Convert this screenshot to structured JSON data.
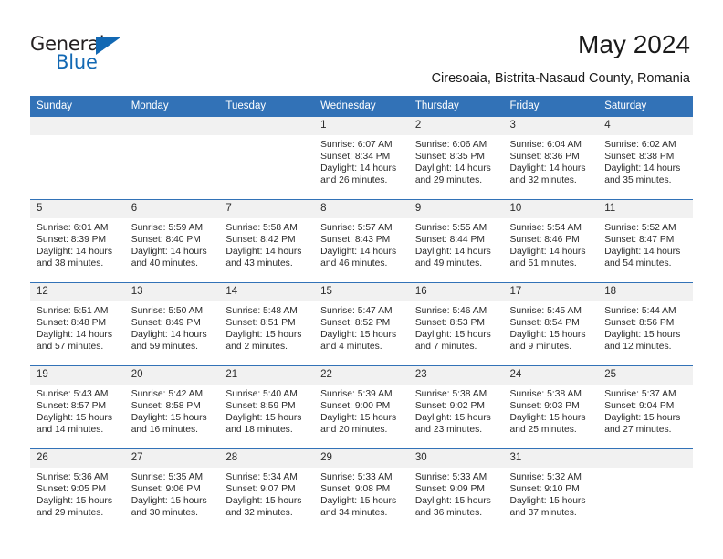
{
  "brand": {
    "name_top": "General",
    "name_bottom": "Blue",
    "triangle_icon": "triangle-icon",
    "color_black": "#231f20",
    "color_blue": "#1268b3"
  },
  "header": {
    "title": "May 2024",
    "subtitle": "Ciresoaia, Bistrita-Nasaud County, Romania"
  },
  "theme": {
    "header_blue": "#3272b7",
    "daynum_band": "#f1f1f1",
    "text": "#2b2b2b"
  },
  "calendar": {
    "weekday_headers": [
      "Sunday",
      "Monday",
      "Tuesday",
      "Wednesday",
      "Thursday",
      "Friday",
      "Saturday"
    ],
    "weeks": [
      [
        {
          "day": "",
          "empty": true,
          "sunrise": "",
          "sunset": "",
          "daylight_1": "",
          "daylight_2": ""
        },
        {
          "day": "",
          "empty": true,
          "sunrise": "",
          "sunset": "",
          "daylight_1": "",
          "daylight_2": ""
        },
        {
          "day": "",
          "empty": true,
          "sunrise": "",
          "sunset": "",
          "daylight_1": "",
          "daylight_2": ""
        },
        {
          "day": "1",
          "empty": false,
          "sunrise": "Sunrise: 6:07 AM",
          "sunset": "Sunset: 8:34 PM",
          "daylight_1": "Daylight: 14 hours",
          "daylight_2": "and 26 minutes."
        },
        {
          "day": "2",
          "empty": false,
          "sunrise": "Sunrise: 6:06 AM",
          "sunset": "Sunset: 8:35 PM",
          "daylight_1": "Daylight: 14 hours",
          "daylight_2": "and 29 minutes."
        },
        {
          "day": "3",
          "empty": false,
          "sunrise": "Sunrise: 6:04 AM",
          "sunset": "Sunset: 8:36 PM",
          "daylight_1": "Daylight: 14 hours",
          "daylight_2": "and 32 minutes."
        },
        {
          "day": "4",
          "empty": false,
          "sunrise": "Sunrise: 6:02 AM",
          "sunset": "Sunset: 8:38 PM",
          "daylight_1": "Daylight: 14 hours",
          "daylight_2": "and 35 minutes."
        }
      ],
      [
        {
          "day": "5",
          "empty": false,
          "sunrise": "Sunrise: 6:01 AM",
          "sunset": "Sunset: 8:39 PM",
          "daylight_1": "Daylight: 14 hours",
          "daylight_2": "and 38 minutes."
        },
        {
          "day": "6",
          "empty": false,
          "sunrise": "Sunrise: 5:59 AM",
          "sunset": "Sunset: 8:40 PM",
          "daylight_1": "Daylight: 14 hours",
          "daylight_2": "and 40 minutes."
        },
        {
          "day": "7",
          "empty": false,
          "sunrise": "Sunrise: 5:58 AM",
          "sunset": "Sunset: 8:42 PM",
          "daylight_1": "Daylight: 14 hours",
          "daylight_2": "and 43 minutes."
        },
        {
          "day": "8",
          "empty": false,
          "sunrise": "Sunrise: 5:57 AM",
          "sunset": "Sunset: 8:43 PM",
          "daylight_1": "Daylight: 14 hours",
          "daylight_2": "and 46 minutes."
        },
        {
          "day": "9",
          "empty": false,
          "sunrise": "Sunrise: 5:55 AM",
          "sunset": "Sunset: 8:44 PM",
          "daylight_1": "Daylight: 14 hours",
          "daylight_2": "and 49 minutes."
        },
        {
          "day": "10",
          "empty": false,
          "sunrise": "Sunrise: 5:54 AM",
          "sunset": "Sunset: 8:46 PM",
          "daylight_1": "Daylight: 14 hours",
          "daylight_2": "and 51 minutes."
        },
        {
          "day": "11",
          "empty": false,
          "sunrise": "Sunrise: 5:52 AM",
          "sunset": "Sunset: 8:47 PM",
          "daylight_1": "Daylight: 14 hours",
          "daylight_2": "and 54 minutes."
        }
      ],
      [
        {
          "day": "12",
          "empty": false,
          "sunrise": "Sunrise: 5:51 AM",
          "sunset": "Sunset: 8:48 PM",
          "daylight_1": "Daylight: 14 hours",
          "daylight_2": "and 57 minutes."
        },
        {
          "day": "13",
          "empty": false,
          "sunrise": "Sunrise: 5:50 AM",
          "sunset": "Sunset: 8:49 PM",
          "daylight_1": "Daylight: 14 hours",
          "daylight_2": "and 59 minutes."
        },
        {
          "day": "14",
          "empty": false,
          "sunrise": "Sunrise: 5:48 AM",
          "sunset": "Sunset: 8:51 PM",
          "daylight_1": "Daylight: 15 hours",
          "daylight_2": "and 2 minutes."
        },
        {
          "day": "15",
          "empty": false,
          "sunrise": "Sunrise: 5:47 AM",
          "sunset": "Sunset: 8:52 PM",
          "daylight_1": "Daylight: 15 hours",
          "daylight_2": "and 4 minutes."
        },
        {
          "day": "16",
          "empty": false,
          "sunrise": "Sunrise: 5:46 AM",
          "sunset": "Sunset: 8:53 PM",
          "daylight_1": "Daylight: 15 hours",
          "daylight_2": "and 7 minutes."
        },
        {
          "day": "17",
          "empty": false,
          "sunrise": "Sunrise: 5:45 AM",
          "sunset": "Sunset: 8:54 PM",
          "daylight_1": "Daylight: 15 hours",
          "daylight_2": "and 9 minutes."
        },
        {
          "day": "18",
          "empty": false,
          "sunrise": "Sunrise: 5:44 AM",
          "sunset": "Sunset: 8:56 PM",
          "daylight_1": "Daylight: 15 hours",
          "daylight_2": "and 12 minutes."
        }
      ],
      [
        {
          "day": "19",
          "empty": false,
          "sunrise": "Sunrise: 5:43 AM",
          "sunset": "Sunset: 8:57 PM",
          "daylight_1": "Daylight: 15 hours",
          "daylight_2": "and 14 minutes."
        },
        {
          "day": "20",
          "empty": false,
          "sunrise": "Sunrise: 5:42 AM",
          "sunset": "Sunset: 8:58 PM",
          "daylight_1": "Daylight: 15 hours",
          "daylight_2": "and 16 minutes."
        },
        {
          "day": "21",
          "empty": false,
          "sunrise": "Sunrise: 5:40 AM",
          "sunset": "Sunset: 8:59 PM",
          "daylight_1": "Daylight: 15 hours",
          "daylight_2": "and 18 minutes."
        },
        {
          "day": "22",
          "empty": false,
          "sunrise": "Sunrise: 5:39 AM",
          "sunset": "Sunset: 9:00 PM",
          "daylight_1": "Daylight: 15 hours",
          "daylight_2": "and 20 minutes."
        },
        {
          "day": "23",
          "empty": false,
          "sunrise": "Sunrise: 5:38 AM",
          "sunset": "Sunset: 9:02 PM",
          "daylight_1": "Daylight: 15 hours",
          "daylight_2": "and 23 minutes."
        },
        {
          "day": "24",
          "empty": false,
          "sunrise": "Sunrise: 5:38 AM",
          "sunset": "Sunset: 9:03 PM",
          "daylight_1": "Daylight: 15 hours",
          "daylight_2": "and 25 minutes."
        },
        {
          "day": "25",
          "empty": false,
          "sunrise": "Sunrise: 5:37 AM",
          "sunset": "Sunset: 9:04 PM",
          "daylight_1": "Daylight: 15 hours",
          "daylight_2": "and 27 minutes."
        }
      ],
      [
        {
          "day": "26",
          "empty": false,
          "sunrise": "Sunrise: 5:36 AM",
          "sunset": "Sunset: 9:05 PM",
          "daylight_1": "Daylight: 15 hours",
          "daylight_2": "and 29 minutes."
        },
        {
          "day": "27",
          "empty": false,
          "sunrise": "Sunrise: 5:35 AM",
          "sunset": "Sunset: 9:06 PM",
          "daylight_1": "Daylight: 15 hours",
          "daylight_2": "and 30 minutes."
        },
        {
          "day": "28",
          "empty": false,
          "sunrise": "Sunrise: 5:34 AM",
          "sunset": "Sunset: 9:07 PM",
          "daylight_1": "Daylight: 15 hours",
          "daylight_2": "and 32 minutes."
        },
        {
          "day": "29",
          "empty": false,
          "sunrise": "Sunrise: 5:33 AM",
          "sunset": "Sunset: 9:08 PM",
          "daylight_1": "Daylight: 15 hours",
          "daylight_2": "and 34 minutes."
        },
        {
          "day": "30",
          "empty": false,
          "sunrise": "Sunrise: 5:33 AM",
          "sunset": "Sunset: 9:09 PM",
          "daylight_1": "Daylight: 15 hours",
          "daylight_2": "and 36 minutes."
        },
        {
          "day": "31",
          "empty": false,
          "sunrise": "Sunrise: 5:32 AM",
          "sunset": "Sunset: 9:10 PM",
          "daylight_1": "Daylight: 15 hours",
          "daylight_2": "and 37 minutes."
        },
        {
          "day": "",
          "empty": true,
          "sunrise": "",
          "sunset": "",
          "daylight_1": "",
          "daylight_2": ""
        }
      ]
    ]
  }
}
